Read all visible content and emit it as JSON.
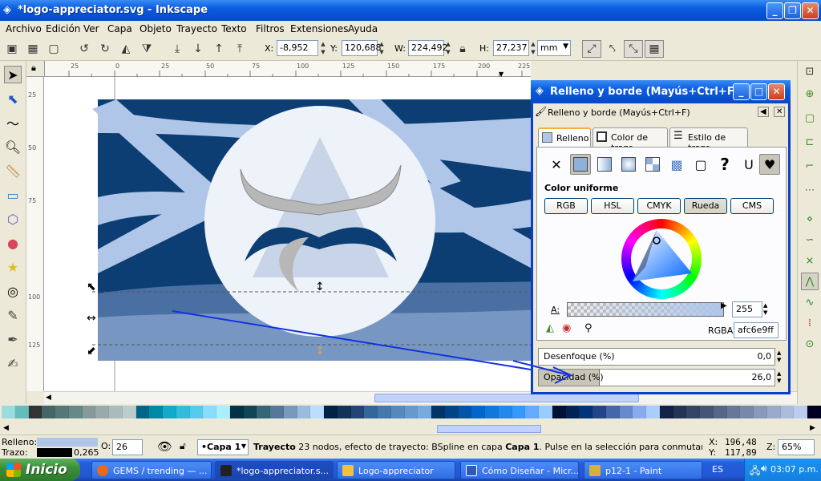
{
  "window": {
    "title": "*logo-appreciator.svg - Inkscape",
    "buttons": [
      "_",
      "❐",
      "✕"
    ]
  },
  "menu": [
    "Archivo",
    "Edición",
    "Ver",
    "Capa",
    "Objeto",
    "Trayecto",
    "Texto",
    "Filtros",
    "Extensiones",
    "Ayuda"
  ],
  "toolbar": {
    "x_label": "X:",
    "x_value": "-8,952",
    "y_label": "Y:",
    "y_value": "120,688",
    "w_label": "W:",
    "w_value": "224,492",
    "h_label": "H:",
    "h_value": "27,237",
    "unit": "mm"
  },
  "ruler_top": [
    "25",
    "0",
    "25",
    "50",
    "75",
    "100",
    "125",
    "150",
    "175",
    "200",
    "225"
  ],
  "ruler_left": [
    "25",
    "50",
    "75",
    "100",
    "125"
  ],
  "dialog": {
    "title": "Relleno y borde (Mayús+Ctrl+F)",
    "subtitle": "Relleno y borde (Mayús+Ctrl+F)",
    "tabs": [
      "Relleno",
      "Color de trazo",
      "Estilo de trazo"
    ],
    "fill_type": "Color uniforme",
    "color_modes": [
      "RGB",
      "HSL",
      "CMYK",
      "Rueda",
      "CMS"
    ],
    "alpha_label": "A:",
    "alpha_value": "255",
    "rgba_label": "RGBA:",
    "rgba_value": "afc6e9ff",
    "blur_label": "Desenfoque (%)",
    "blur_value": "0,0",
    "opacity_label": "Opacidad (%)",
    "opacity_value": "26,0",
    "opacity_percent": 26
  },
  "status": {
    "fill_label": "Relleno:",
    "stroke_label": "Trazo:",
    "stroke_width": "0,265",
    "o_label": "O:",
    "o_value": "26",
    "layer": "•Capa 1",
    "message_bold": "Trayecto",
    "message": " 23 nodos, efecto de trayecto: BSpline en capa ",
    "message_layer": "Capa 1",
    "message_tail": ". Pulse en la selección para conmutar los tiradore…",
    "x_label": "X:",
    "x_value": "196,48",
    "y_label": "Y:",
    "y_value": "117,89",
    "z_label": "Z:",
    "zoom": "65%",
    "fill_color": "#afc6e9",
    "stroke_color": "#000000"
  },
  "taskbar": {
    "start": "Inicio",
    "tasks": [
      "GEMS / trending — ...",
      "*logo-appreciator.s...",
      "Logo-appreciator",
      "Cómo Diseñar - Micr...",
      "p12-1 - Paint"
    ],
    "lang": "ES",
    "time": "03:07 p.m."
  },
  "palette": [
    "#99dddd",
    "#66bbbb",
    "#333333",
    "#446666",
    "#557777",
    "#668888",
    "#889999",
    "#99aaaa",
    "#aabbbb",
    "#bbcccc",
    "#006688",
    "#0088aa",
    "#11aacc",
    "#33bbdd",
    "#55ccee",
    "#88ddff",
    "#aaeeff",
    "#003344",
    "#114455",
    "#336677",
    "#557799",
    "#7799bb",
    "#99bbdd",
    "#bbddff",
    "#002244",
    "#113355",
    "#224477",
    "#336699",
    "#4477aa",
    "#5588bb",
    "#6699cc",
    "#77aadd",
    "#003366",
    "#004488",
    "#0055aa",
    "#0066cc",
    "#1177dd",
    "#2288ee",
    "#3399ff",
    "#66aaff",
    "#99ccff",
    "#001133",
    "#002255",
    "#003377",
    "#224488",
    "#4466aa",
    "#6688cc",
    "#88aaee",
    "#aaccff",
    "#112244",
    "#223355",
    "#334466",
    "#445577",
    "#556688",
    "#667799",
    "#7788aa",
    "#8899bb",
    "#99aacc",
    "#aabbdd",
    "#bbccee",
    "#000022"
  ]
}
